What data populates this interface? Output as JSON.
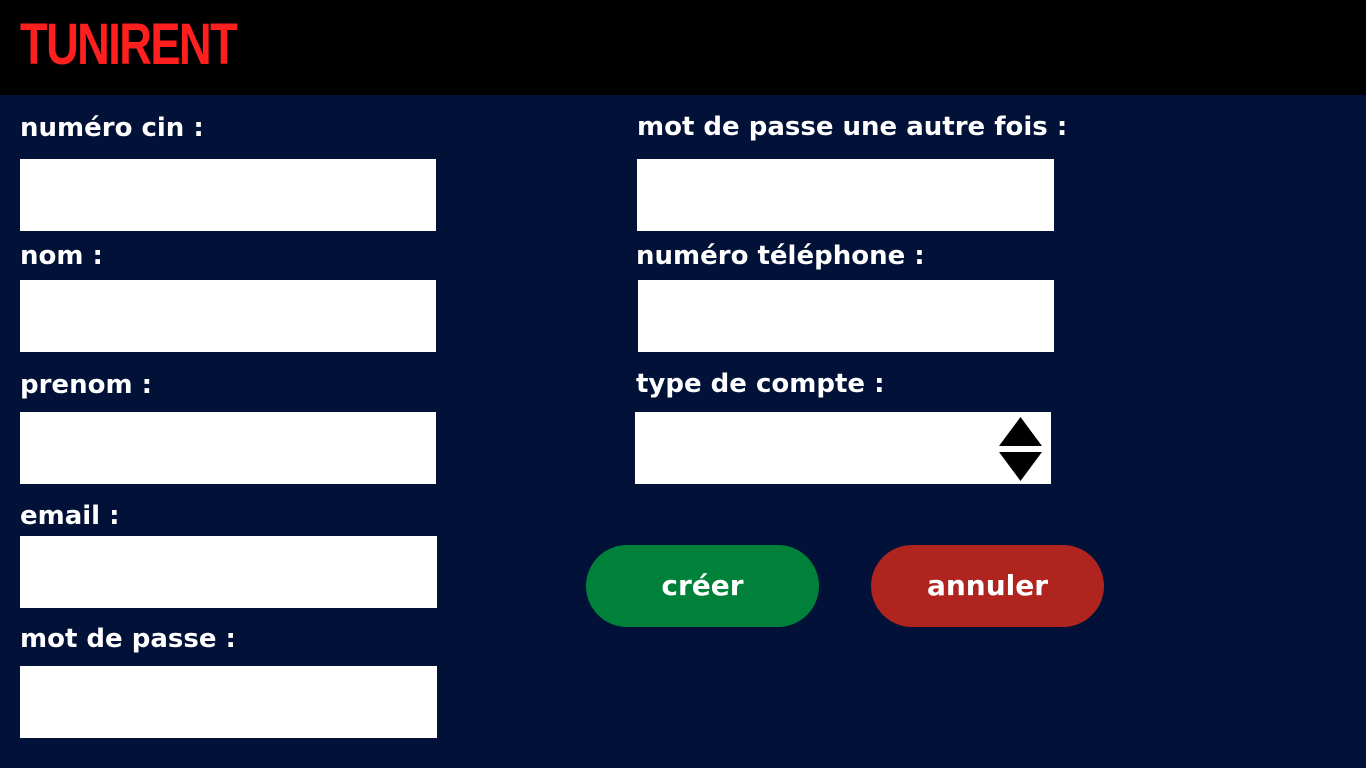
{
  "app": {
    "logo": "TUNIRENT"
  },
  "form": {
    "fields": {
      "cin": {
        "label": "numéro cin :",
        "value": "",
        "placeholder": ""
      },
      "nom": {
        "label": "nom :",
        "value": "",
        "placeholder": ""
      },
      "prenom": {
        "label": "prenom :",
        "value": "",
        "placeholder": ""
      },
      "email": {
        "label": "email :",
        "value": "",
        "placeholder": ""
      },
      "password": {
        "label": "mot de passe :",
        "value": "",
        "placeholder": ""
      },
      "password_confirm": {
        "label": "mot de passe une autre fois :",
        "value": "",
        "placeholder": ""
      },
      "telephone": {
        "label": "numéro téléphone :",
        "value": "",
        "placeholder": ""
      },
      "account_type": {
        "label": "type de compte :",
        "value": ""
      }
    },
    "buttons": {
      "create": "créer",
      "cancel": "annuler"
    }
  },
  "colors": {
    "background": "#021137",
    "header": "#000000",
    "logo": "#ff1f1f",
    "create_button": "#00813a",
    "cancel_button": "#b02420"
  },
  "icons": {
    "account_type_spinner": "up-down-arrows-icon"
  }
}
